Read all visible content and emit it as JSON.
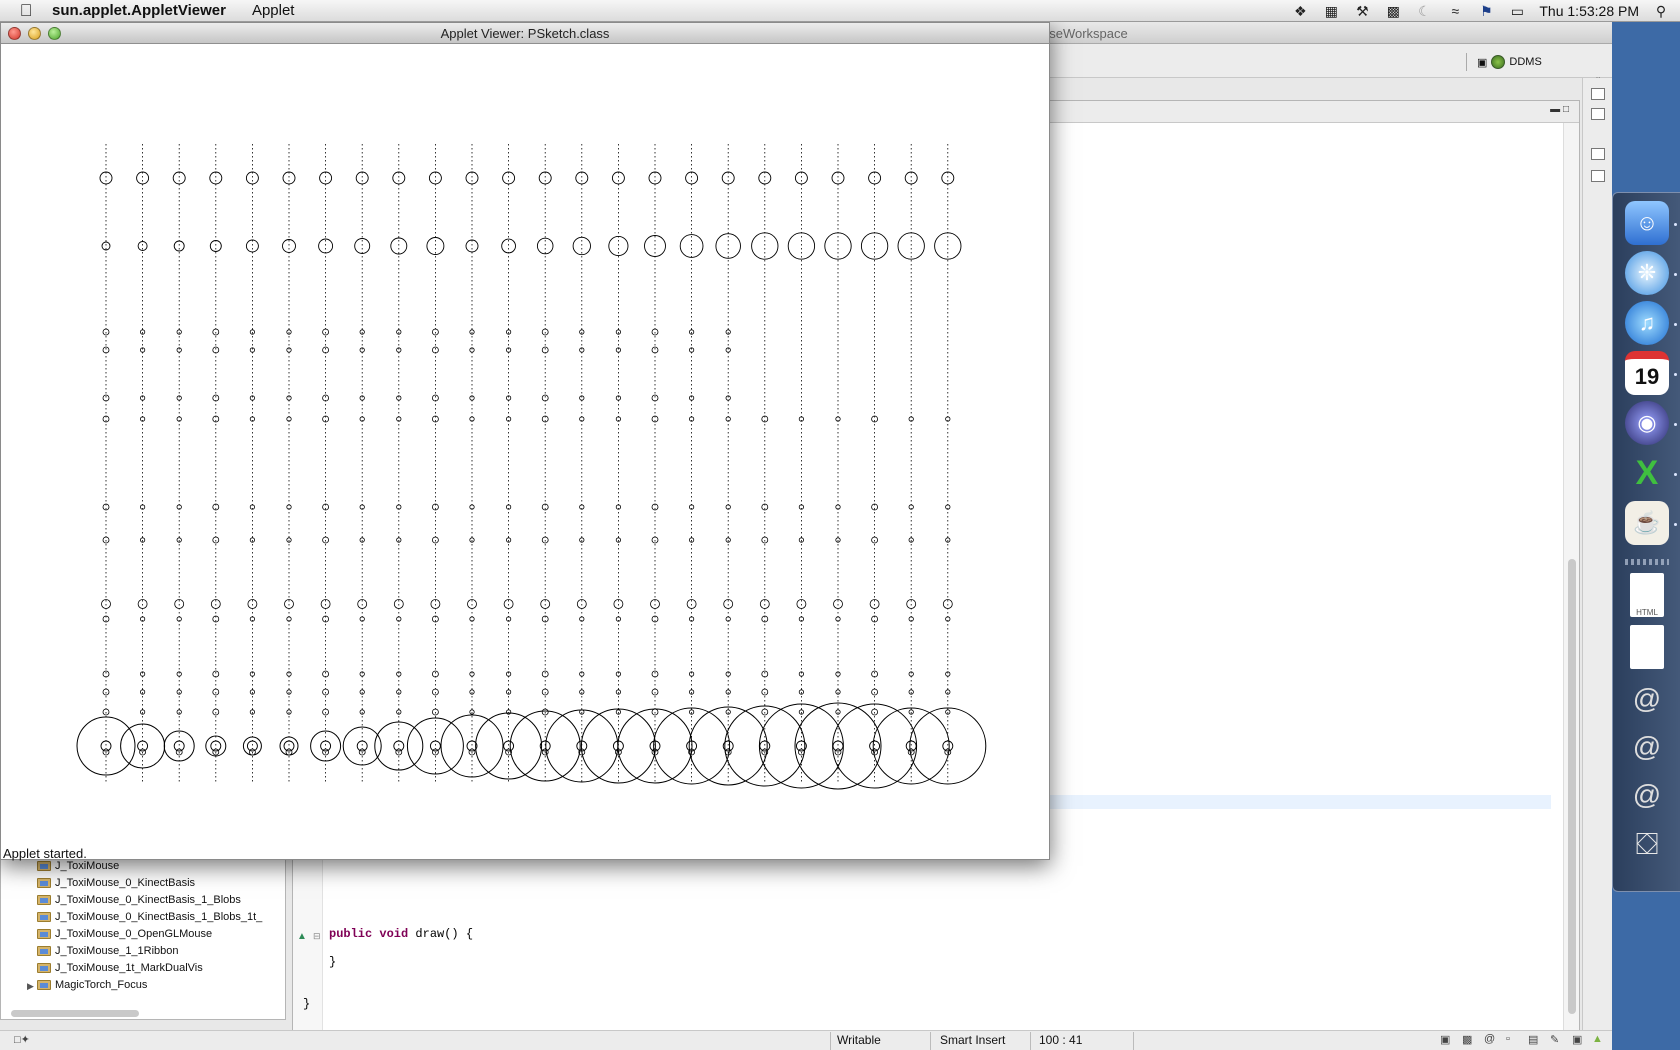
{
  "menubar": {
    "app_name": "sun.applet.AppletViewer",
    "menus": [
      "Applet"
    ],
    "clock": "Thu 1:53:28 PM",
    "status_icons": [
      "dropbox-icon",
      "screen-icon",
      "tools-icon",
      "app-icon",
      "moon-icon",
      "wifi-icon",
      "flag-icon",
      "battery-icon",
      "spotlight-icon"
    ]
  },
  "applet": {
    "title": "Applet Viewer: PSketch.class",
    "status": "Applet started."
  },
  "eclipse": {
    "title_fragment": "oseWorkspace",
    "perspective_label": "DDMS",
    "code": {
      "line1_keywords": "public void",
      "line1_rest": " draw() {",
      "line2": "}",
      "line3": "}"
    },
    "packages": [
      "J_ToxiMouse",
      "J_ToxiMouse_0_KinectBasis",
      "J_ToxiMouse_0_KinectBasis_1_Blobs",
      "J_ToxiMouse_0_KinectBasis_1_Blobs_1t_",
      "J_ToxiMouse_0_OpenGLMouse",
      "J_ToxiMouse_1_1Ribbon",
      "J_ToxiMouse_1t_MarkDualVis",
      "MagicTorch_Focus"
    ],
    "status": {
      "writable": "Writable",
      "insert_mode": "Smart Insert",
      "position": "100 : 41"
    }
  },
  "dock": {
    "apps": [
      "finder-icon",
      "safari-icon",
      "itunes-icon",
      "ical-icon",
      "eclipse-icon",
      "excel-icon",
      "coffee-icon",
      "html-doc-icon",
      "blank-doc-icon",
      "mail-stack-icon",
      "mail-stack-icon",
      "mail-stack-icon",
      "trash-icon"
    ],
    "calendar_day": "19"
  },
  "colors": {
    "desktop": "#3d6aa6",
    "keyword": "#7f0055",
    "line_highlight": "#e8f2fe"
  }
}
